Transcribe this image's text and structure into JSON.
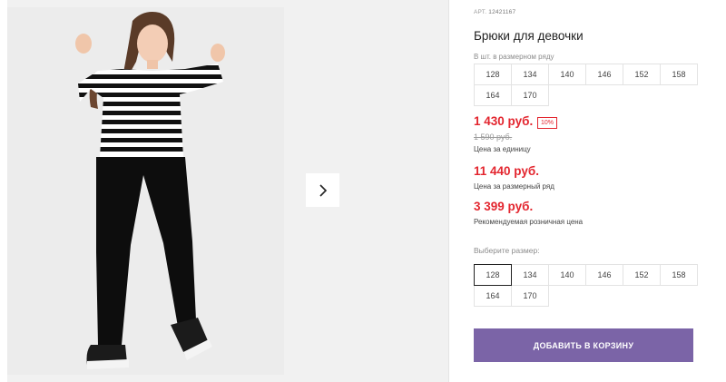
{
  "product": {
    "article_label": "АРТ.",
    "article_value": "12421167",
    "title": "Брюки для девочки"
  },
  "size_row": {
    "label": "В шт. в размерном ряду",
    "sizes": [
      "128",
      "134",
      "140",
      "146",
      "152",
      "158",
      "164",
      "170"
    ]
  },
  "pricing": {
    "current_price": "1 430 руб.",
    "discount_badge": "10%",
    "old_price": "1 590 руб.",
    "unit_note": "Цена за единицу",
    "row_price": "11 440 руб.",
    "row_note": "Цена за размерный ряд",
    "retail_price": "3 399 руб.",
    "retail_note": "Рекомендуемая розничная цена"
  },
  "size_select": {
    "label": "Выберите размер:",
    "sizes": [
      "128",
      "134",
      "140",
      "146",
      "152",
      "158",
      "164",
      "170"
    ],
    "selected": "128"
  },
  "actions": {
    "add_to_cart": "ДОБАВИТЬ В КОРЗИНУ"
  },
  "colors": {
    "price_red": "#e3262f",
    "cart_button": "#7b64a7"
  },
  "icons": {
    "next": "chevron-right-icon"
  }
}
